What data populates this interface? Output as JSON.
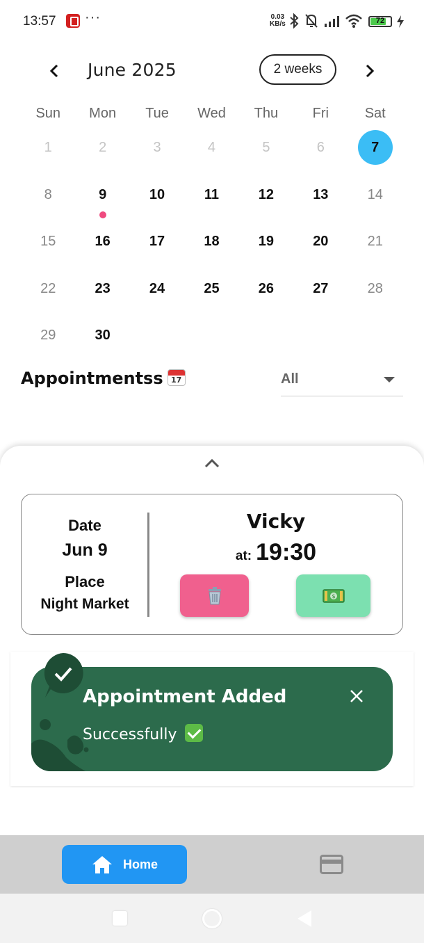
{
  "status_bar": {
    "time": "13:57",
    "speed_value": "0.03",
    "speed_unit": "KB/s",
    "battery": "72"
  },
  "calendar": {
    "month_title": "June 2025",
    "format_button": "2 weeks",
    "days_of_week": [
      "Sun",
      "Mon",
      "Tue",
      "Wed",
      "Thu",
      "Fri",
      "Sat"
    ],
    "weeks": [
      [
        "1",
        "2",
        "3",
        "4",
        "5",
        "6",
        "7"
      ],
      [
        "8",
        "9",
        "10",
        "11",
        "12",
        "13",
        "14"
      ],
      [
        "15",
        "16",
        "17",
        "18",
        "19",
        "20",
        "21"
      ],
      [
        "22",
        "23",
        "24",
        "25",
        "26",
        "27",
        "28"
      ],
      [
        "29",
        "30",
        "",
        "",
        "",
        "",
        ""
      ]
    ],
    "selected_day": "7",
    "event_day": "9",
    "colors": {
      "selected": "#3bbdf5",
      "event_marker": "#ef4a7f"
    }
  },
  "appointments": {
    "heading": "Appointmentss",
    "filter_value": "All"
  },
  "appointment_card": {
    "date_label": "Date",
    "date_value": "Jun 9",
    "place_label": "Place",
    "place_value": "Night Market",
    "client_name": "Vicky",
    "at_label": "at:",
    "time": "19:30",
    "colors": {
      "delete_button": "#f0608e",
      "pay_button": "#7ce0b0"
    }
  },
  "toast": {
    "title": "Appointment Added",
    "message": "Successfully",
    "color": "#2c6b4c"
  },
  "bottom_nav": {
    "home_label": "Home",
    "active_color": "#2196f3"
  }
}
